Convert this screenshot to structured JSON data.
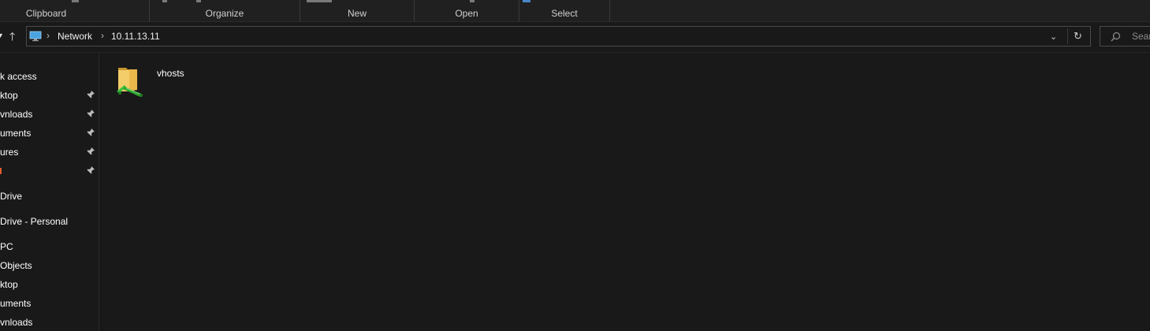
{
  "ribbon": {
    "groups": [
      "Clipboard",
      "Organize",
      "New",
      "Open",
      "Select"
    ]
  },
  "address_bar": {
    "crumbs": [
      "Network",
      "10.11.13.11"
    ],
    "search_placeholder": "Sear"
  },
  "nav": {
    "items": [
      {
        "label": "k access",
        "pinned": false
      },
      {
        "label": "ktop",
        "pinned": true
      },
      {
        "label": "vnloads",
        "pinned": true
      },
      {
        "label": "uments",
        "pinned": true
      },
      {
        "label": "ures",
        "pinned": true
      },
      {
        "label": "",
        "pinned": true
      },
      {
        "label": "Drive",
        "pinned": false
      },
      {
        "label": "Drive - Personal",
        "pinned": false
      },
      {
        "label": "PC",
        "pinned": false
      },
      {
        "label": "Objects",
        "pinned": false
      },
      {
        "label": "ktop",
        "pinned": false
      },
      {
        "label": "uments",
        "pinned": false
      },
      {
        "label": "vnloads",
        "pinned": false
      }
    ]
  },
  "content": {
    "items": [
      {
        "name": "vhosts",
        "icon": "network-share-folder-icon"
      }
    ]
  },
  "colors": {
    "background": "#191919",
    "folder": "#e8b84a",
    "network": "#3cc43c"
  }
}
